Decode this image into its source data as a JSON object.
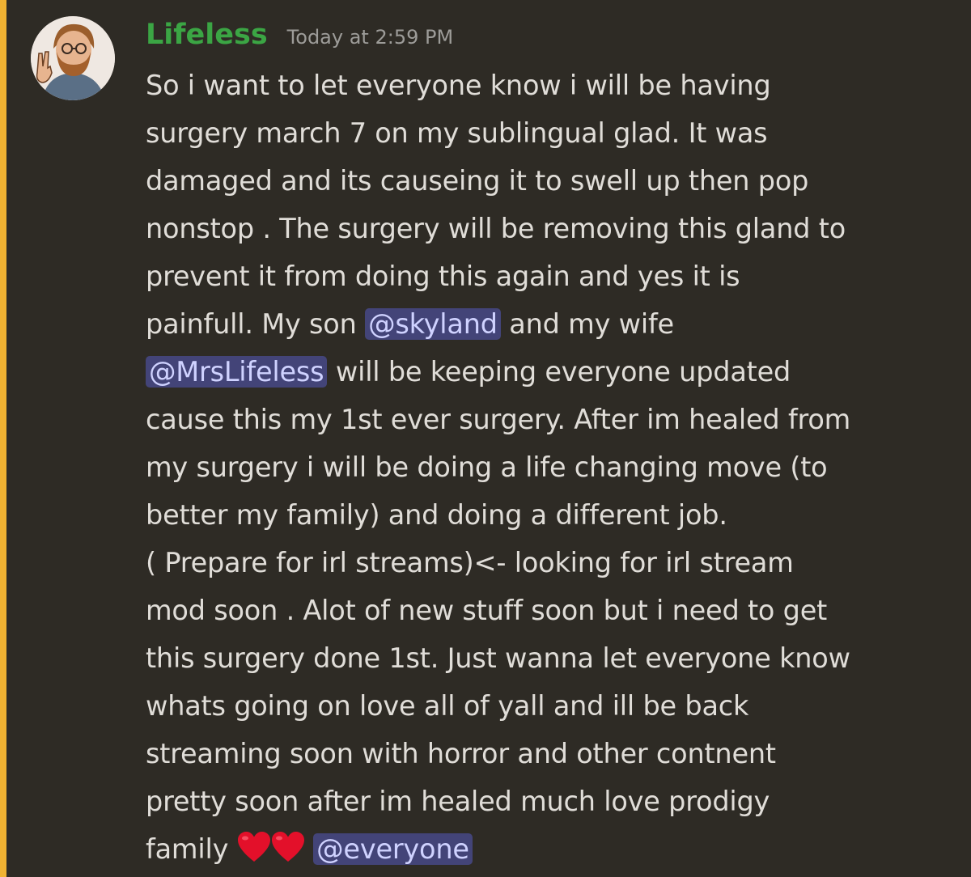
{
  "message": {
    "author": "Lifeless",
    "timestamp": "Today at 2:59 PM",
    "lines": [
      "So i want to let everyone know i will be having",
      "surgery march 7 on my sublingual glad. It was",
      "damaged and its causeing it to swell up then pop",
      "nonstop . The surgery will be removing this gland to",
      "prevent it from doing this again  and yes it is"
    ],
    "line6_before": "painfull. My son",
    "mention_skyland": "@skyland",
    "line6_after": "and my wife",
    "mention_mrslifeless": "@MrsLifeless",
    "line7_after": "will be keeping everyone updated",
    "lines_b": [
      "cause this my 1st ever surgery. After im healed from",
      "my surgery i will be doing a life changing move (to",
      "better my family) and doing a different job.",
      "( Prepare for irl streams)<- looking for irl stream",
      "mod soon . Alot of new stuff soon but i need to get",
      "this surgery done 1st. Just wanna let everyone know",
      "whats going on love all of yall and ill be back",
      "streaming soon with horror and other contnent",
      "pretty soon after im healed much love prodigy"
    ],
    "last_line_before": "family",
    "emoji": [
      "heart-emoji",
      "heart-emoji"
    ],
    "mention_everyone": "@everyone"
  },
  "colors": {
    "background": "#2e2b25",
    "highlight_bar": "#f0b232",
    "username": "#3ba544",
    "timestamp": "#9d9c99",
    "text": "#e0ddd8",
    "mention_bg": "#434478",
    "mention_text": "#cfd2ff"
  }
}
